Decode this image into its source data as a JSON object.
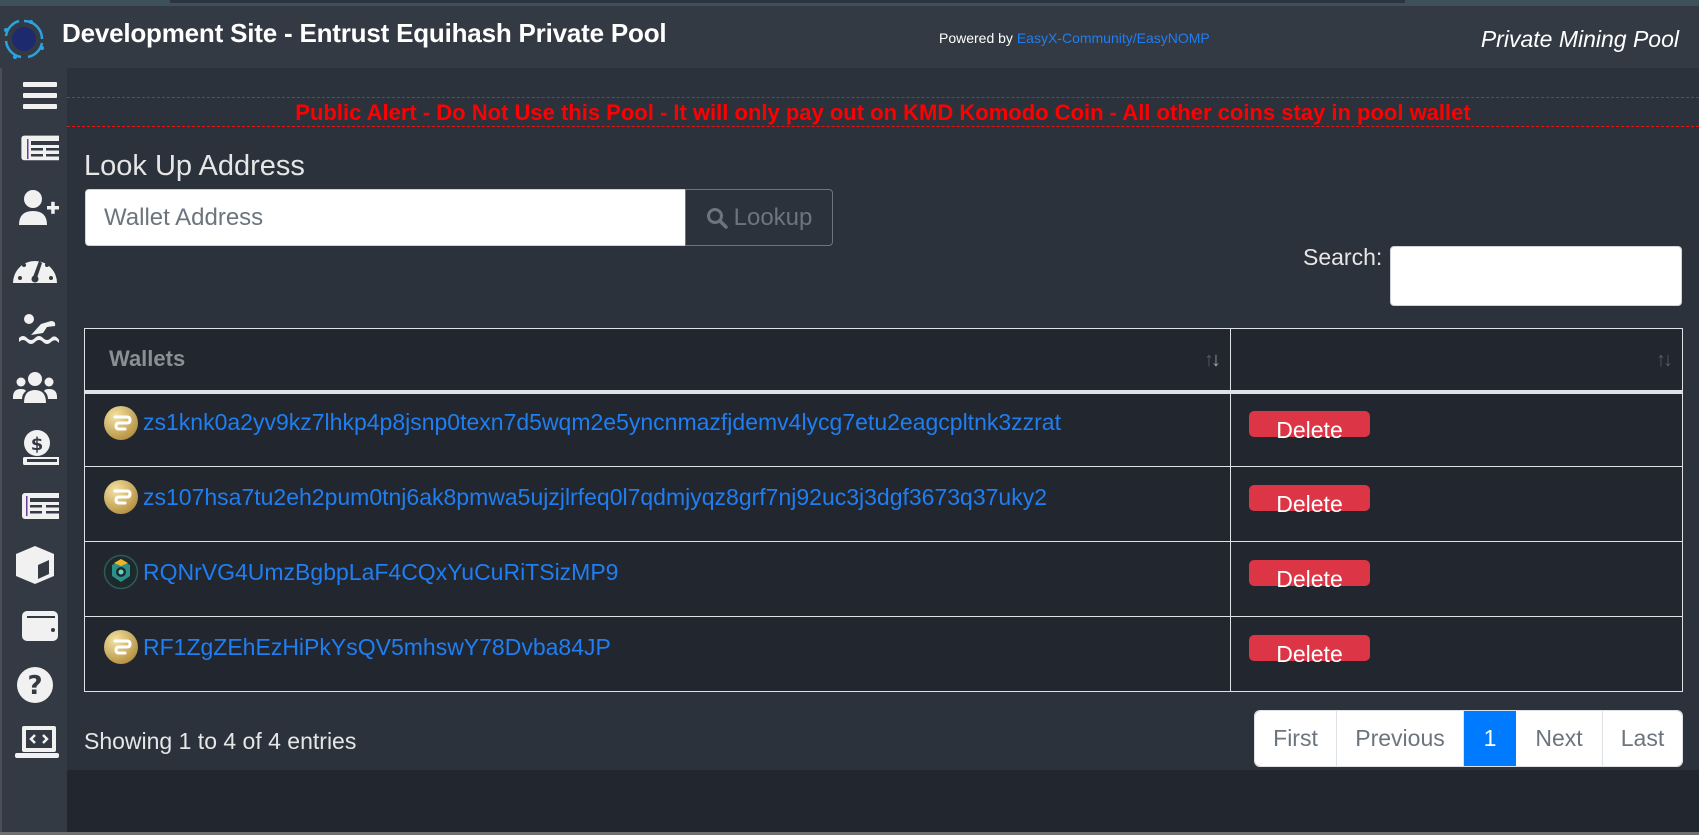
{
  "header": {
    "title": "Development Site - Entrust Equihash Private Pool",
    "powered_by_prefix": "Powered by ",
    "powered_by_link": "EasyX-Community/EasyNOMP",
    "tagline": "Private Mining Pool"
  },
  "sidebar": {
    "items": [
      {
        "icon": "hamburger-menu-icon"
      },
      {
        "icon": "newspaper-icon"
      },
      {
        "icon": "user-plus-icon"
      },
      {
        "icon": "tachometer-icon"
      },
      {
        "icon": "swimmer-icon"
      },
      {
        "icon": "users-icon"
      },
      {
        "icon": "hand-holding-dollar-icon"
      },
      {
        "icon": "newspaper-icon"
      },
      {
        "icon": "cube-icon"
      },
      {
        "icon": "wallet-icon"
      },
      {
        "icon": "question-circle-icon"
      },
      {
        "icon": "laptop-code-icon"
      }
    ]
  },
  "alert": {
    "text": "Public Alert - Do Not Use this Pool - It will only pay out on KMD Komodo Coin - All other coins stay in pool wallet",
    "color": "#ff0000"
  },
  "lookup": {
    "title": "Look Up Address",
    "placeholder": "Wallet Address",
    "value": "",
    "button_label": "Lookup"
  },
  "search": {
    "label": "Search:",
    "value": ""
  },
  "table": {
    "columns": [
      "Wallets",
      ""
    ],
    "rows": [
      {
        "coin": "gold-coin",
        "address": "zs1knk0a2yv9kz7lhkp4p8jsnp0texn7d5wqm2e5yncnmazfjdemv4lycg7etu2eagcpltnk3zzrat",
        "action": "Delete"
      },
      {
        "coin": "gold-coin",
        "address": "zs107hsa7tu2eh2pum0tnj6ak8pmwa5ujzjlrfeq0l7qdmjyqz8grf7nj92uc3j3dgf3673q37uky2",
        "action": "Delete"
      },
      {
        "coin": "komodo-coin",
        "address": "RQNrVG4UmzBgbpLaF4CQxYuCuRiTSizMP9",
        "action": "Delete"
      },
      {
        "coin": "gold-coin",
        "address": "RF1ZgZEhEzHiPkYsQV5mhswY78Dvba84JP",
        "action": "Delete"
      }
    ]
  },
  "info": "Showing 1 to 4 of 4 entries",
  "pagination": {
    "first": "First",
    "previous": "Previous",
    "current": "1",
    "next": "Next",
    "last": "Last"
  },
  "colors": {
    "link": "#1f7ef2",
    "danger": "#dc3545",
    "active_page": "#007bff"
  }
}
